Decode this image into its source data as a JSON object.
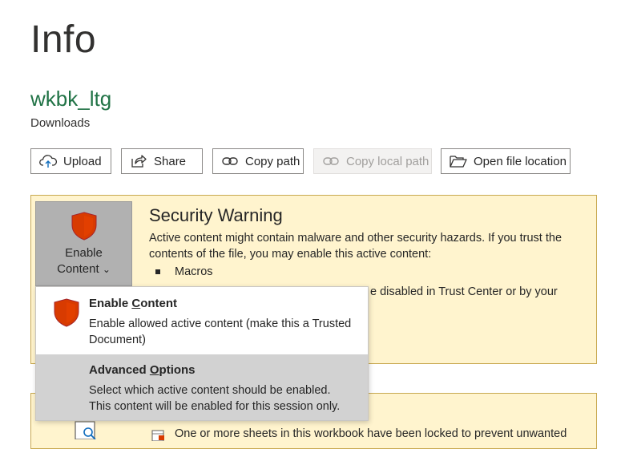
{
  "page": {
    "title": "Info"
  },
  "file": {
    "name": "wkbk_ltg",
    "location": "Downloads"
  },
  "toolbar": {
    "upload": "Upload",
    "share": "Share",
    "copy_path": "Copy path",
    "copy_local_path": "Copy local path",
    "open_file_location": "Open file location"
  },
  "security": {
    "title": "Security Warning",
    "description": "Active content might contain malware and other security hazards. If you trust the contents of the file, you may enable this active content:",
    "bullets": [
      "Macros"
    ],
    "partial_text": "e disabled in Trust Center or by your",
    "enable_button": {
      "line1": "Enable",
      "line2": "Content",
      "chevron": "⌄"
    }
  },
  "dropdown": {
    "items": [
      {
        "title": "Enable Content",
        "title_prefix": "Enable ",
        "title_accel": "C",
        "title_suffix": "ontent",
        "description": "Enable allowed active content (make this a Trusted Document)",
        "icon": "shield-icon"
      },
      {
        "title": "Advanced Options",
        "title_prefix": "Advanced ",
        "title_accel": "O",
        "title_suffix": "ptions",
        "description": "Select which active content should be enabled. This content will be enabled for this session only.",
        "highlighted": true
      }
    ]
  },
  "protect": {
    "text": "One or more sheets in this workbook have been locked to prevent unwanted"
  },
  "colors": {
    "accent_green": "#217346",
    "warning_bg": "#fff4ce",
    "warning_border": "#c8a951",
    "shield_red": "#d83b01"
  }
}
